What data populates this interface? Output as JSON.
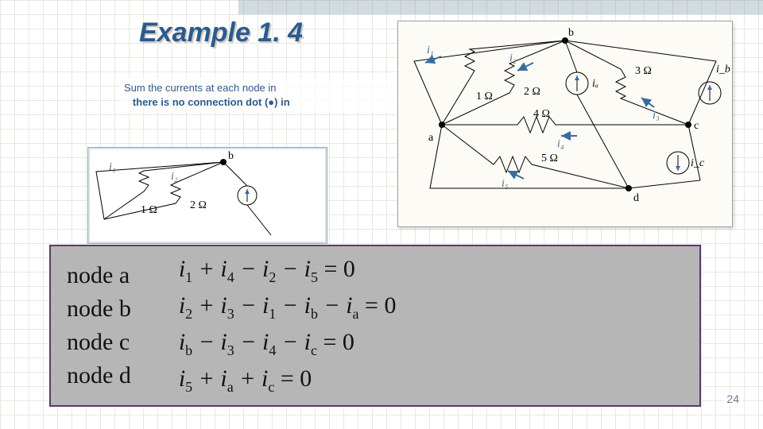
{
  "title": "Example 1. 4",
  "instruction_line1": "Sum the currents at each node in ",
  "instruction_line2_bold": "there is no connection dot (●) in",
  "page_number": "24",
  "circuit": {
    "nodes": {
      "a": "a",
      "b": "b",
      "c": "c",
      "d": "d"
    },
    "currents": {
      "i1": "i₁",
      "i2": "i₂",
      "i3": "i₃",
      "i4": "i₄",
      "i5": "i₅",
      "ia": "iₐ",
      "ib": "i_b",
      "ic": "i_c"
    },
    "resistors": {
      "r1": "1 Ω",
      "r2": "2 Ω",
      "r3": "3 Ω",
      "r4": "4 Ω",
      "r5": "5 Ω"
    }
  },
  "equations": {
    "labels": [
      "node a",
      "node b",
      "node c",
      "node d"
    ],
    "eqs_plain": [
      "i1 + i4 - i2 - i5 = 0",
      "i2 + i3 - i1 - ib - ia = 0",
      "ib - i3 - i4 - ic = 0",
      "i5 + ia + ic = 0"
    ]
  }
}
